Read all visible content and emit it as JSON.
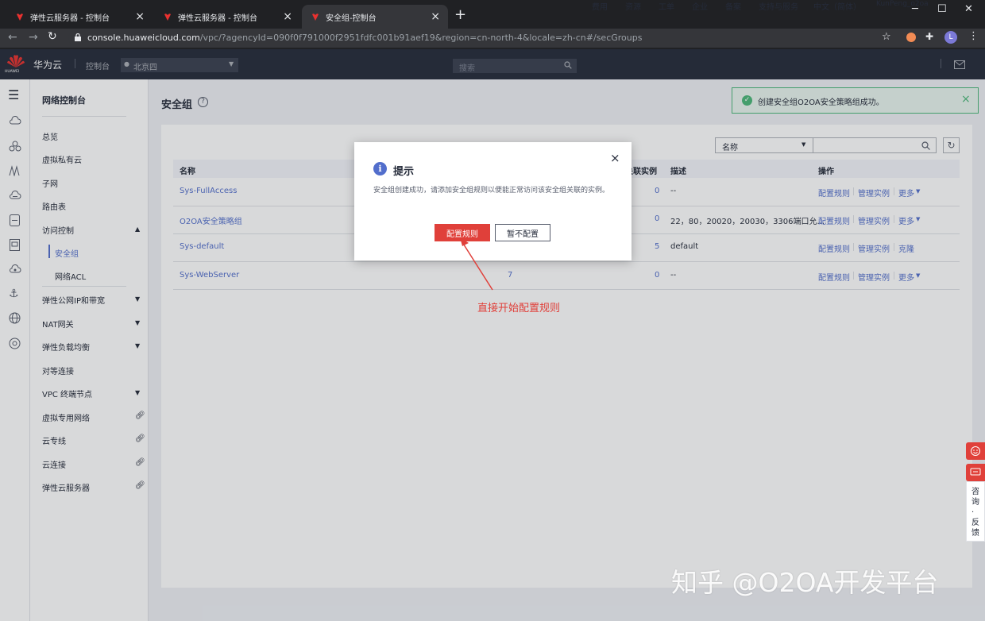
{
  "browser": {
    "tabs": [
      {
        "label": "弹性云服务器 - 控制台"
      },
      {
        "label": "弹性云服务器 - 控制台"
      },
      {
        "label": "安全组-控制台"
      }
    ],
    "new_tab": "+",
    "url_host": "console.huaweicloud.com",
    "url_path": "/vpc/?agencyId=090f0f791000f2951fdfc001b91aef19&region=cn-north-4&locale=zh-cn#/secGroups",
    "profile_initial": "L"
  },
  "topbar": {
    "brand": "华为云",
    "logo_text": "HUAWEI",
    "console": "控制台",
    "region": "北京四",
    "search_placeholder": "搜索",
    "links": [
      "费用",
      "资源",
      "工单",
      "企业",
      "备案",
      "支持与服务",
      "中文（简体）",
      "KunPeng_o2oa"
    ]
  },
  "nav": {
    "title": "网络控制台",
    "items": [
      "总览",
      "虚拟私有云",
      "子网",
      "路由表",
      "访问控制",
      "安全组",
      "网络ACL",
      "弹性公网IP和带宽",
      "NAT网关",
      "弹性负载均衡",
      "对等连接",
      "VPC 终端节点",
      "虚拟专用网络",
      "云专线",
      "云连接",
      "弹性云服务器"
    ]
  },
  "page": {
    "title": "安全组",
    "filter_label": "名称",
    "columns": [
      "名称",
      "关联实例",
      "描述",
      "操作"
    ],
    "rows": [
      {
        "name": "Sys-FullAccess",
        "rules": "",
        "instances": "0",
        "desc": "--",
        "ops": [
          "配置规则",
          "管理实例",
          "更多"
        ]
      },
      {
        "name": "O2OA安全策略组",
        "rules": "",
        "instances": "0",
        "desc": "22，80，20020，20030，3306端口允...",
        "ops": [
          "配置规则",
          "管理实例",
          "更多"
        ]
      },
      {
        "name": "Sys-default",
        "rules": "",
        "instances": "5",
        "desc": "default",
        "ops": [
          "配置规则",
          "管理实例",
          "克隆"
        ]
      },
      {
        "name": "Sys-WebServer",
        "rules": "7",
        "instances": "0",
        "desc": "--",
        "ops": [
          "配置规则",
          "管理实例",
          "更多"
        ]
      }
    ]
  },
  "toast": {
    "message": "创建安全组O2OA安全策略组成功。"
  },
  "modal": {
    "title": "提示",
    "body": "安全组创建成功，请添加安全组规则以便能正常访问该安全组关联的实例。",
    "confirm": "配置规则",
    "cancel": "暂不配置"
  },
  "annotation": "直接开始配置规则",
  "float_panel": {
    "label": "咨询·反馈"
  },
  "watermark": "知乎 @O2OA开发平台",
  "colors": {
    "brand": "#c7000b",
    "link": "#526ecc",
    "accent_red": "#e0403a",
    "topbar": "#252b3a"
  }
}
